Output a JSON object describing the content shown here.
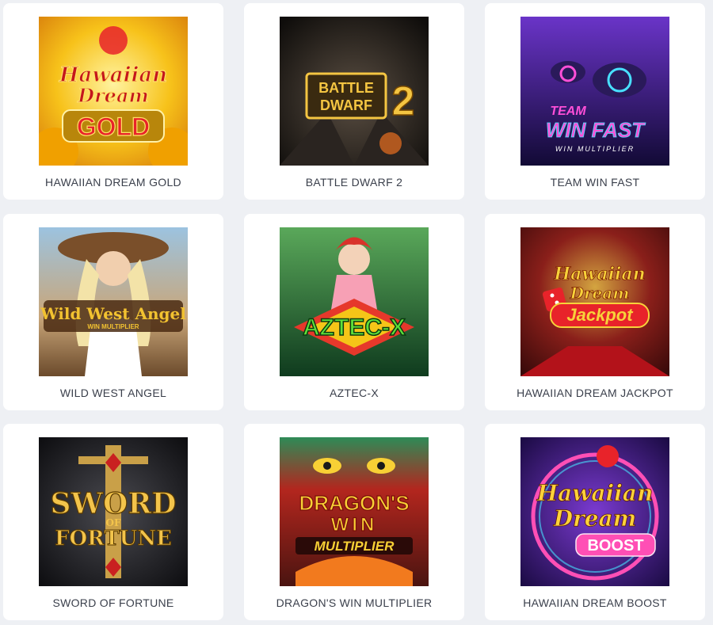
{
  "games": [
    {
      "title": "HAWAIIAN DREAM GOLD",
      "art_text": [
        "Hawaiian",
        "Dream",
        "GOLD"
      ],
      "colors": {
        "bg1": "#f7c21a",
        "bg2": "#e08a0c",
        "text": "#c4161c",
        "accent": "#ffe066"
      }
    },
    {
      "title": "BATTLE DWARF 2",
      "art_text": [
        "BATTLE",
        "DWARF",
        "2"
      ],
      "colors": {
        "bg1": "#3b3733",
        "bg2": "#141210",
        "text": "#f4c542",
        "accent": "#d2651f"
      }
    },
    {
      "title": "TEAM WIN FAST",
      "art_text": [
        "TEAM",
        "WIN FAST",
        "WIN MULTIPLIER"
      ],
      "colors": {
        "bg1": "#5a2ca8",
        "bg2": "#1a1045",
        "text": "#ff4fd8",
        "accent": "#48e0ff"
      }
    },
    {
      "title": "WILD WEST ANGEL",
      "art_text": [
        "Wild West Angel",
        "WIN MULTIPLIER"
      ],
      "colors": {
        "bg1": "#8fb6d6",
        "bg2": "#6b4a2b",
        "text": "#f2c230",
        "accent": "#4a2a12"
      }
    },
    {
      "title": "AZTEC-X",
      "art_text": [
        "AZTEC-X"
      ],
      "colors": {
        "bg1": "#2f7a3a",
        "bg2": "#0f3b1e",
        "text": "#5ee03a",
        "accent": "#e6382b"
      }
    },
    {
      "title": "HAWAIIAN DREAM JACKPOT",
      "art_text": [
        "Hawaiian",
        "Dream",
        "Jackpot"
      ],
      "colors": {
        "bg1": "#8a1f1a",
        "bg2": "#3a0a0a",
        "text": "#f7d23a",
        "accent": "#e8232a"
      }
    },
    {
      "title": "SWORD OF FORTUNE",
      "art_text": [
        "SWORD",
        "OF",
        "FORTUNE"
      ],
      "colors": {
        "bg1": "#2a2a2e",
        "bg2": "#0d0d10",
        "text": "#f3c44b",
        "accent": "#c92020"
      }
    },
    {
      "title": "DRAGON'S WIN MULTIPLIER",
      "art_text": [
        "DRAGON'S",
        "WIN",
        "MULTIPLIER"
      ],
      "colors": {
        "bg1": "#b3261e",
        "bg2": "#4a1410",
        "text": "#f8d035",
        "accent": "#2e8b57"
      }
    },
    {
      "title": "HAWAIIAN DREAM BOOST",
      "art_text": [
        "Hawaiian",
        "Dream",
        "BOOST"
      ],
      "colors": {
        "bg1": "#5a1e9e",
        "bg2": "#1b0b44",
        "text": "#ffd23a",
        "accent": "#ff4fb5"
      }
    }
  ]
}
